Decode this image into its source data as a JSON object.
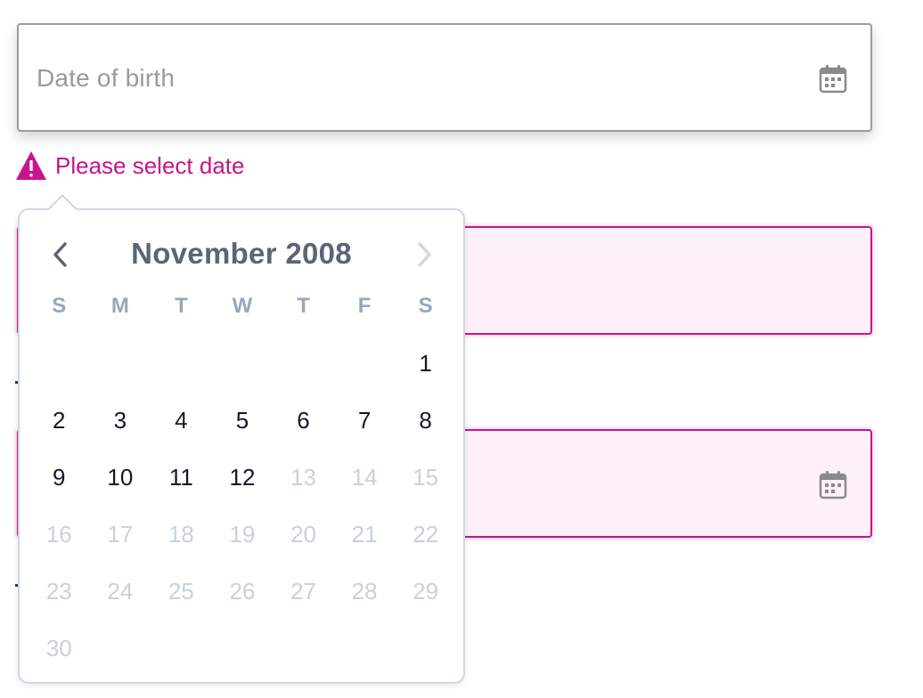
{
  "form": {
    "date_of_birth": {
      "placeholder": "Date of birth",
      "icon": "calendar-icon"
    },
    "error": {
      "icon": "warning-icon",
      "message": "Please select date"
    }
  },
  "datepicker": {
    "month_label": "November 2008",
    "prev_icon": "chevron-left-icon",
    "next_icon": "chevron-right-icon",
    "weekdays": [
      "S",
      "M",
      "T",
      "W",
      "T",
      "F",
      "S"
    ],
    "weeks": [
      [
        "",
        "",
        "",
        "",
        "",
        "",
        "1"
      ],
      [
        "2",
        "3",
        "4",
        "5",
        "6",
        "7",
        "8"
      ],
      [
        "9",
        "10",
        "11",
        "12",
        "13",
        "14",
        "15"
      ],
      [
        "16",
        "17",
        "18",
        "19",
        "20",
        "21",
        "22"
      ],
      [
        "23",
        "24",
        "25",
        "26",
        "27",
        "28",
        "29"
      ],
      [
        "30",
        "",
        "",
        "",
        "",
        "",
        ""
      ]
    ],
    "disabled_after": 12
  },
  "colors": {
    "error": "#c7158a",
    "error_bg": "#fdf0f8",
    "title": "#5b6576",
    "weekday": "#9aa6b8",
    "day": "#111827",
    "day_disabled": "#c9d1dc"
  }
}
